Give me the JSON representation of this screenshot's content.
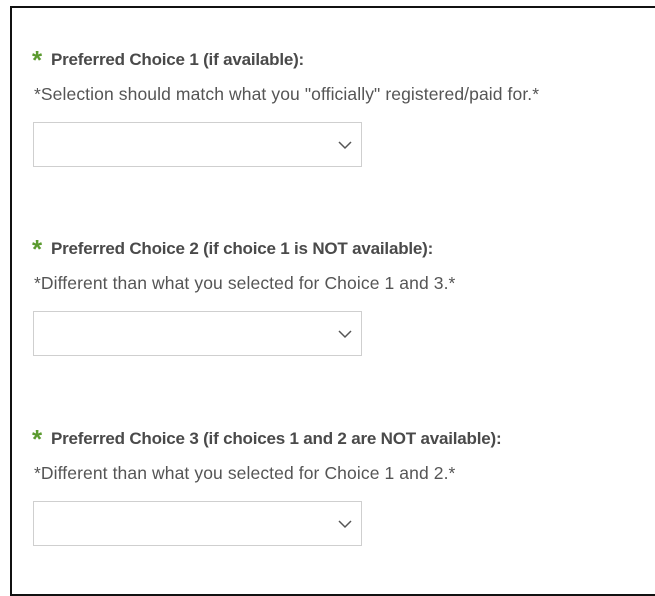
{
  "form": {
    "fields": [
      {
        "required_mark": "*",
        "label": "Preferred Choice 1 (if available):",
        "note": "*Selection should match what you \"officially\" registered/paid for.*",
        "selected_value": ""
      },
      {
        "required_mark": "*",
        "label": "Preferred Choice 2 (if choice 1 is NOT available):",
        "note": "*Different than what you selected for Choice 1 and 3.*",
        "selected_value": ""
      },
      {
        "required_mark": "*",
        "label": "Preferred Choice 3 (if choices 1 and 2 are NOT available):",
        "note": "*Different than what you selected for Choice 1 and 2.*",
        "selected_value": ""
      }
    ],
    "colors": {
      "required_star": "#5b9a2f",
      "label_text": "#4a4a4a",
      "note_text": "#555555",
      "select_border": "#cfcfcf",
      "frame_border": "#111111"
    },
    "icons": {
      "select_arrow": "chevron-down-icon"
    }
  }
}
